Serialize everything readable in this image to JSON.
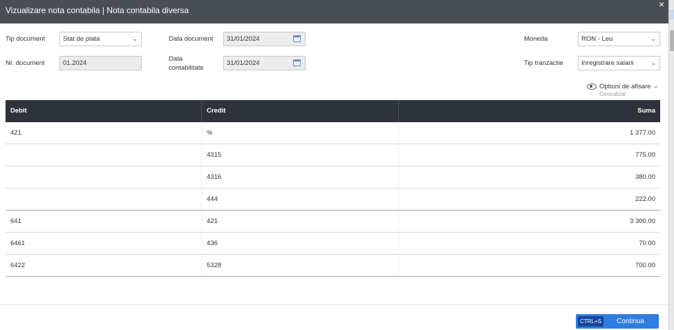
{
  "dialog": {
    "title": "Vizualizare nota contabila | Nota contabila diversa",
    "close_glyph": "×"
  },
  "form": {
    "tip_document": {
      "label": "Tip document",
      "value": "Stat de plata"
    },
    "data_document": {
      "label": "Data document",
      "value": "31/01/2024"
    },
    "moneda": {
      "label": "Moneda",
      "value": "RON - Leu"
    },
    "nr_document": {
      "label": "Nr. document",
      "value": "01.2024"
    },
    "data_contabilitate": {
      "label_line1": "Data",
      "label_line2": "contabilitate",
      "value": "31/01/2024"
    },
    "tip_tranzactie": {
      "label": "Tip tranzactie",
      "value": "Inregistrare salarii"
    }
  },
  "display_options": {
    "label": "Optiuni de afisare",
    "sublabel": "Centralizat",
    "icon": "eye-icon"
  },
  "table": {
    "columns": {
      "debit": "Debit",
      "credit": "Credit",
      "suma": "Suma"
    },
    "rows": [
      {
        "debit": "421",
        "credit": "%",
        "suma": "1 377.00"
      },
      {
        "debit": "",
        "credit": "4315",
        "suma": "775.00"
      },
      {
        "debit": "",
        "credit": "4316",
        "suma": "380.00"
      },
      {
        "debit": "",
        "credit": "444",
        "suma": "222.00"
      },
      {
        "debit": "641",
        "credit": "421",
        "suma": "3 300.00"
      },
      {
        "debit": "6461",
        "credit": "436",
        "suma": "70.00"
      },
      {
        "debit": "6422",
        "credit": "5328",
        "suma": "700.00"
      }
    ]
  },
  "footer": {
    "shortcut": "CTRL+S",
    "continue_label": "Continua"
  },
  "colors": {
    "titlebar": "#4a4e55",
    "table_header": "#2e323a",
    "primary_button": "#2f7de1",
    "shortcut_badge": "#17459c"
  }
}
